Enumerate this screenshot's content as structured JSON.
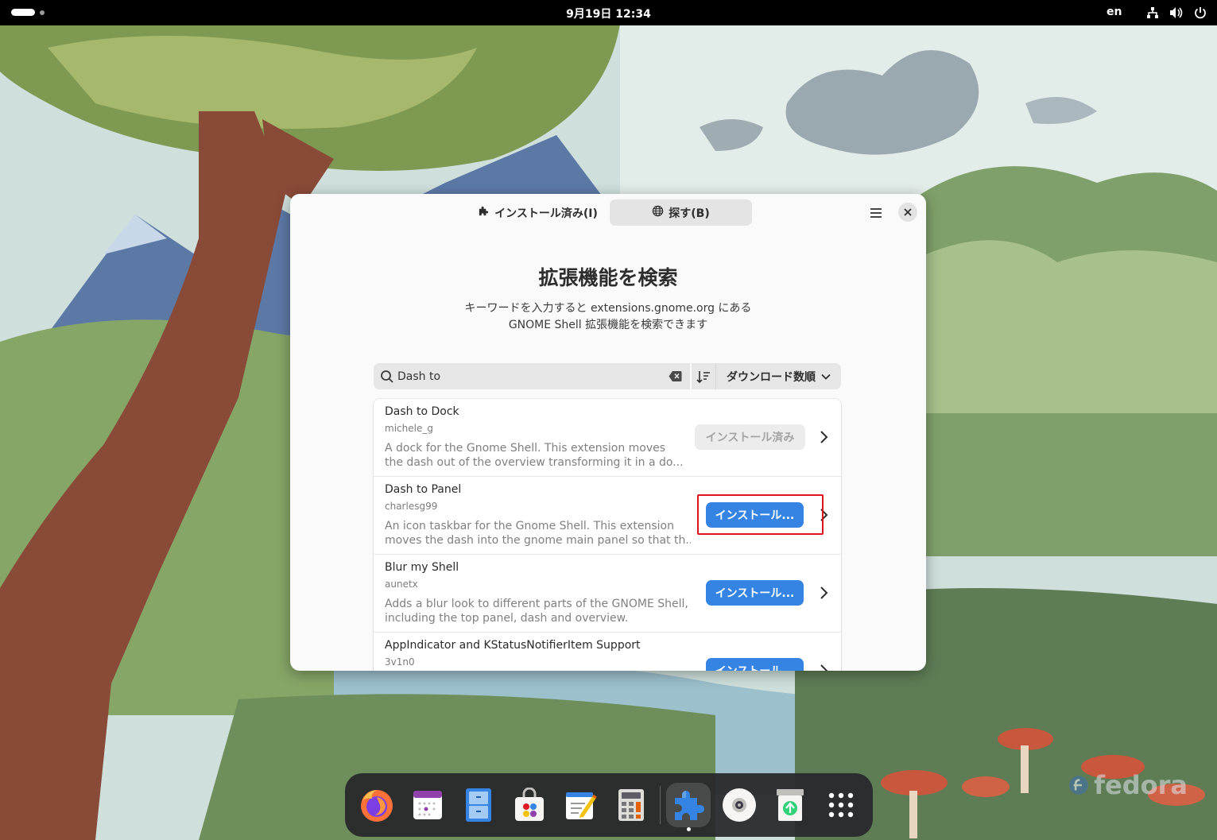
{
  "topbar": {
    "clock": "9月19日  12:34",
    "language": "en",
    "tray_icons": [
      "network-icon",
      "volume-icon",
      "power-icon"
    ]
  },
  "window": {
    "tabs": [
      {
        "label": "インストール済み(I)",
        "icon": "puzzle-icon",
        "active": false
      },
      {
        "label": "探す(B)",
        "icon": "globe-icon",
        "active": true
      }
    ],
    "title": "拡張機能を検索",
    "description_line1": "キーワードを入力すると extensions.gnome.org にある",
    "description_line2": "GNOME Shell 拡張機能を検索できます",
    "search": {
      "value": "Dash to",
      "placeholder": ""
    },
    "sort": {
      "selected": "ダウンロード数順"
    },
    "results": [
      {
        "name": "Dash to Dock",
        "author": "michele_g",
        "desc_line1": "A dock for the Gnome Shell. This extension moves",
        "desc_line2": "the dash out of the overview transforming it in a do...",
        "button": "インストール済み",
        "installed": true
      },
      {
        "name": "Dash to Panel",
        "author": "charlesg99",
        "desc_line1": "An icon taskbar for the Gnome Shell. This extension",
        "desc_line2": "moves the dash into the gnome main panel so that th...",
        "button": "インストール...",
        "installed": false
      },
      {
        "name": "Blur my Shell",
        "author": "aunetx",
        "desc_line1": "Adds a blur look to different parts of the GNOME Shell,",
        "desc_line2": "including the top panel, dash and overview.",
        "button": "インストール...",
        "installed": false
      },
      {
        "name": "AppIndicator and KStatusNotifierItem Support",
        "author": "3v1n0",
        "desc_line1": "",
        "desc_line2": "",
        "button": "インストール...",
        "installed": false
      }
    ]
  },
  "dock": {
    "apps": [
      "firefox-icon",
      "calendar-icon",
      "files-icon",
      "software-icon",
      "text-editor-icon",
      "calculator-icon",
      "extension-manager-icon",
      "disk-icon",
      "trash-icon",
      "app-grid-icon"
    ]
  },
  "branding": {
    "wallpaper_logo": "fedora"
  },
  "colors": {
    "accent": "#3584e4",
    "highlight": "#e0141e",
    "topbar": "#000000"
  }
}
